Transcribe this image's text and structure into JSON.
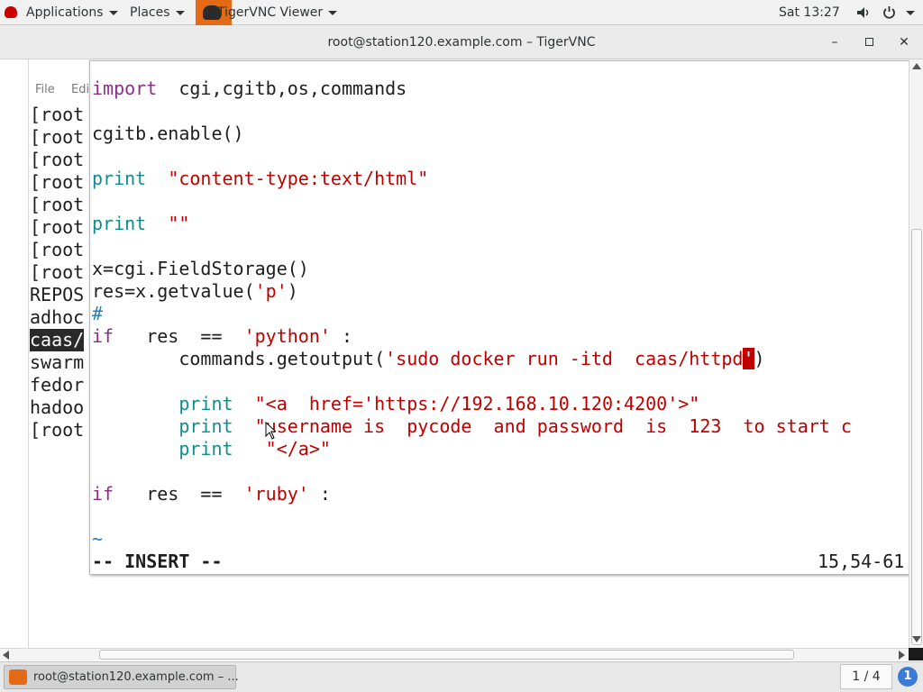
{
  "topbar": {
    "applications": "Applications",
    "places": "Places",
    "app_name": "TigerVNC Viewer",
    "clock": "Sat 13:27"
  },
  "window": {
    "title": "root@station120.example.com – TigerVNC"
  },
  "terminal_bg": {
    "menu_file": "File",
    "menu_edit": "Edi",
    "lines": [
      "[root",
      "[root",
      "[root",
      "[root",
      "[root",
      "[root",
      "[root",
      "[root",
      "REPOS",
      "adhoc",
      "caas/",
      "swarm",
      "fedor",
      "hadoo",
      "[root"
    ]
  },
  "editor": {
    "lines": [
      [
        "import",
        "  cgi,cgitb,os,commands"
      ],
      [
        "cgitb.enable()"
      ],
      [
        "print",
        "  ",
        "\"content-type:text/html\""
      ],
      [
        "print",
        "  ",
        "\"\""
      ],
      [
        "x=cgi.FieldStorage()"
      ],
      [
        "res=x.getvalue(",
        "'p'",
        ")"
      ],
      [
        "#"
      ],
      [
        "if",
        "   res  ==  ",
        "'python'",
        " :"
      ],
      [
        "        commands.getoutput(",
        "'sudo docker run -itd  caas/httpd",
        "'",
        ")"
      ],
      [
        "        ",
        "print",
        "  ",
        "\"<a  href='https://192.168.10.120:4200'>\""
      ],
      [
        "        ",
        "print",
        "  ",
        "\"username is  pycode  and password  is  123  to start c"
      ],
      [
        "        ",
        "print",
        "   ",
        "\"</a>\""
      ],
      [
        "if",
        "   res  ==  ",
        "'ruby'",
        " :"
      ],
      [
        "~"
      ]
    ],
    "mode": "-- INSERT --",
    "position": "15,54-61"
  },
  "taskbar": {
    "task_label": "root@station120.example.com – ...",
    "workspace": "1 / 4",
    "info": "1"
  }
}
